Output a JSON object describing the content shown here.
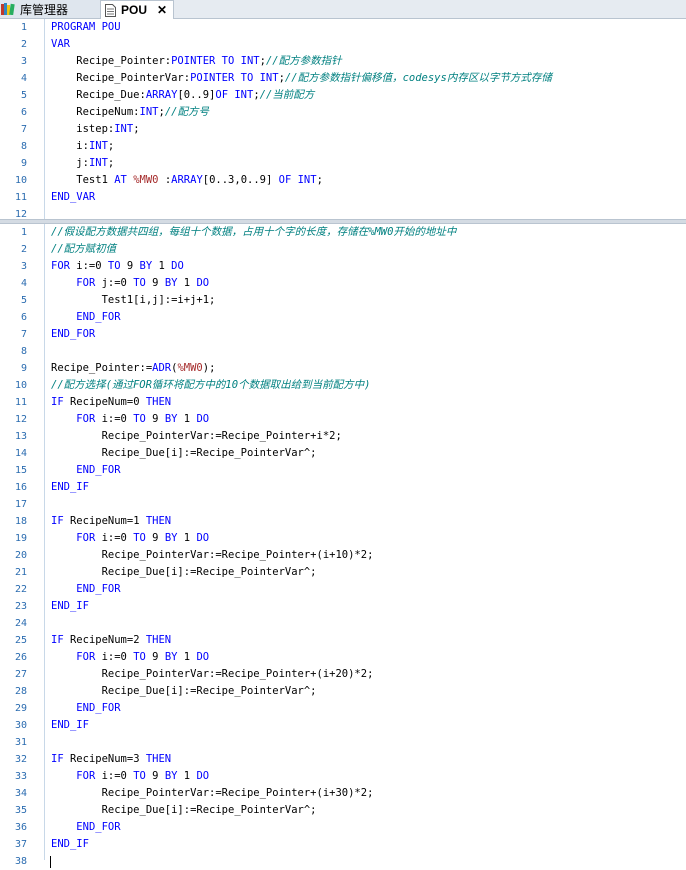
{
  "tabs": [
    {
      "label": "库管理器",
      "icon": "books-icon"
    },
    {
      "label": "POU",
      "icon": "document-icon",
      "close": "✕"
    }
  ],
  "declaration": [
    {
      "n": "1",
      "segs": [
        [
          "kw",
          "PROGRAM POU"
        ]
      ]
    },
    {
      "n": "2",
      "segs": [
        [
          "kw",
          "VAR"
        ]
      ]
    },
    {
      "n": "3",
      "segs": [
        [
          "nm",
          "    Recipe_Pointer:"
        ],
        [
          "kw",
          "POINTER TO INT"
        ],
        [
          "nm",
          ";"
        ],
        [
          "cm",
          "//配方参数指针"
        ]
      ]
    },
    {
      "n": "4",
      "segs": [
        [
          "nm",
          "    Recipe_PointerVar:"
        ],
        [
          "kw",
          "POINTER TO INT"
        ],
        [
          "nm",
          ";"
        ],
        [
          "cm",
          "//配方参数指针偏移值，codesys内存区以字节方式存储"
        ]
      ]
    },
    {
      "n": "5",
      "segs": [
        [
          "nm",
          "    Recipe_Due:"
        ],
        [
          "kw",
          "ARRAY"
        ],
        [
          "nm",
          "[0..9]"
        ],
        [
          "kw",
          "OF INT"
        ],
        [
          "nm",
          ";"
        ],
        [
          "cm",
          "//当前配方"
        ]
      ]
    },
    {
      "n": "6",
      "segs": [
        [
          "nm",
          "    RecipeNum:"
        ],
        [
          "kw",
          "INT"
        ],
        [
          "nm",
          ";"
        ],
        [
          "cm",
          "//配方号"
        ]
      ]
    },
    {
      "n": "7",
      "segs": [
        [
          "nm",
          "    istep:"
        ],
        [
          "kw",
          "INT"
        ],
        [
          "nm",
          ";"
        ]
      ]
    },
    {
      "n": "8",
      "segs": [
        [
          "nm",
          "    i:"
        ],
        [
          "kw",
          "INT"
        ],
        [
          "nm",
          ";"
        ]
      ]
    },
    {
      "n": "9",
      "segs": [
        [
          "nm",
          "    j:"
        ],
        [
          "kw",
          "INT"
        ],
        [
          "nm",
          ";"
        ]
      ]
    },
    {
      "n": "10",
      "segs": [
        [
          "nm",
          "    Test1 "
        ],
        [
          "kw",
          "AT"
        ],
        [
          "nm",
          " "
        ],
        [
          "cm2",
          "%MW0"
        ],
        [
          "nm",
          " :"
        ],
        [
          "kw",
          "ARRAY"
        ],
        [
          "nm",
          "[0..3,0..9] "
        ],
        [
          "kw",
          "OF INT"
        ],
        [
          "nm",
          ";"
        ]
      ]
    },
    {
      "n": "11",
      "segs": [
        [
          "kw",
          "END_VAR"
        ]
      ]
    },
    {
      "n": "12",
      "segs": []
    }
  ],
  "implementation": [
    {
      "n": "1",
      "segs": [
        [
          "cm",
          "//假设配方数据共四组，每组十个数据，占用十个字的长度，存储在%MW0开始的地址中"
        ]
      ]
    },
    {
      "n": "2",
      "segs": [
        [
          "cm",
          "//配方赋初值"
        ]
      ]
    },
    {
      "n": "3",
      "segs": [
        [
          "kw",
          "FOR"
        ],
        [
          "nm",
          " i:=0 "
        ],
        [
          "kw",
          "TO"
        ],
        [
          "nm",
          " 9 "
        ],
        [
          "kw",
          "BY"
        ],
        [
          "nm",
          " 1 "
        ],
        [
          "kw",
          "DO"
        ]
      ]
    },
    {
      "n": "4",
      "segs": [
        [
          "nm",
          "    "
        ],
        [
          "kw",
          "FOR"
        ],
        [
          "nm",
          " j:=0 "
        ],
        [
          "kw",
          "TO"
        ],
        [
          "nm",
          " 9 "
        ],
        [
          "kw",
          "BY"
        ],
        [
          "nm",
          " 1 "
        ],
        [
          "kw",
          "DO"
        ]
      ]
    },
    {
      "n": "5",
      "segs": [
        [
          "nm",
          "        Test1[i,j]:=i+j+1;"
        ]
      ]
    },
    {
      "n": "6",
      "segs": [
        [
          "nm",
          "    "
        ],
        [
          "kw",
          "END_FOR"
        ]
      ]
    },
    {
      "n": "7",
      "segs": [
        [
          "kw",
          "END_FOR"
        ]
      ]
    },
    {
      "n": "8",
      "segs": []
    },
    {
      "n": "9",
      "segs": [
        [
          "nm",
          "Recipe_Pointer:="
        ],
        [
          "kw",
          "ADR"
        ],
        [
          "nm",
          "("
        ],
        [
          "cm2",
          "%MW0"
        ],
        [
          "nm",
          ");"
        ]
      ]
    },
    {
      "n": "10",
      "segs": [
        [
          "cm",
          "//配方选择(通过FOR循环将配方中的10个数据取出给到当前配方中)"
        ]
      ]
    },
    {
      "n": "11",
      "segs": [
        [
          "kw",
          "IF"
        ],
        [
          "nm",
          " RecipeNum=0 "
        ],
        [
          "kw",
          "THEN"
        ]
      ]
    },
    {
      "n": "12",
      "segs": [
        [
          "nm",
          "    "
        ],
        [
          "kw",
          "FOR"
        ],
        [
          "nm",
          " i:=0 "
        ],
        [
          "kw",
          "TO"
        ],
        [
          "nm",
          " 9 "
        ],
        [
          "kw",
          "BY"
        ],
        [
          "nm",
          " 1 "
        ],
        [
          "kw",
          "DO"
        ]
      ]
    },
    {
      "n": "13",
      "segs": [
        [
          "nm",
          "        Recipe_PointerVar:=Recipe_Pointer+i*2;"
        ]
      ]
    },
    {
      "n": "14",
      "segs": [
        [
          "nm",
          "        Recipe_Due[i]:=Recipe_PointerVar^;"
        ]
      ]
    },
    {
      "n": "15",
      "segs": [
        [
          "nm",
          "    "
        ],
        [
          "kw",
          "END_FOR"
        ]
      ]
    },
    {
      "n": "16",
      "segs": [
        [
          "kw",
          "END_IF"
        ]
      ]
    },
    {
      "n": "17",
      "segs": []
    },
    {
      "n": "18",
      "segs": [
        [
          "kw",
          "IF"
        ],
        [
          "nm",
          " RecipeNum=1 "
        ],
        [
          "kw",
          "THEN"
        ]
      ]
    },
    {
      "n": "19",
      "segs": [
        [
          "nm",
          "    "
        ],
        [
          "kw",
          "FOR"
        ],
        [
          "nm",
          " i:=0 "
        ],
        [
          "kw",
          "TO"
        ],
        [
          "nm",
          " 9 "
        ],
        [
          "kw",
          "BY"
        ],
        [
          "nm",
          " 1 "
        ],
        [
          "kw",
          "DO"
        ]
      ]
    },
    {
      "n": "20",
      "segs": [
        [
          "nm",
          "        Recipe_PointerVar:=Recipe_Pointer+(i+10)*2;"
        ]
      ]
    },
    {
      "n": "21",
      "segs": [
        [
          "nm",
          "        Recipe_Due[i]:=Recipe_PointerVar^;"
        ]
      ]
    },
    {
      "n": "22",
      "segs": [
        [
          "nm",
          "    "
        ],
        [
          "kw",
          "END_FOR"
        ]
      ]
    },
    {
      "n": "23",
      "segs": [
        [
          "kw",
          "END_IF"
        ]
      ]
    },
    {
      "n": "24",
      "segs": []
    },
    {
      "n": "25",
      "segs": [
        [
          "kw",
          "IF"
        ],
        [
          "nm",
          " RecipeNum=2 "
        ],
        [
          "kw",
          "THEN"
        ]
      ]
    },
    {
      "n": "26",
      "segs": [
        [
          "nm",
          "    "
        ],
        [
          "kw",
          "FOR"
        ],
        [
          "nm",
          " i:=0 "
        ],
        [
          "kw",
          "TO"
        ],
        [
          "nm",
          " 9 "
        ],
        [
          "kw",
          "BY"
        ],
        [
          "nm",
          " 1 "
        ],
        [
          "kw",
          "DO"
        ]
      ]
    },
    {
      "n": "27",
      "segs": [
        [
          "nm",
          "        Recipe_PointerVar:=Recipe_Pointer+(i+20)*2;"
        ]
      ]
    },
    {
      "n": "28",
      "segs": [
        [
          "nm",
          "        Recipe_Due[i]:=Recipe_PointerVar^;"
        ]
      ]
    },
    {
      "n": "29",
      "segs": [
        [
          "nm",
          "    "
        ],
        [
          "kw",
          "END_FOR"
        ]
      ]
    },
    {
      "n": "30",
      "segs": [
        [
          "kw",
          "END_IF"
        ]
      ]
    },
    {
      "n": "31",
      "segs": []
    },
    {
      "n": "32",
      "segs": [
        [
          "kw",
          "IF"
        ],
        [
          "nm",
          " RecipeNum=3 "
        ],
        [
          "kw",
          "THEN"
        ]
      ]
    },
    {
      "n": "33",
      "segs": [
        [
          "nm",
          "    "
        ],
        [
          "kw",
          "FOR"
        ],
        [
          "nm",
          " i:=0 "
        ],
        [
          "kw",
          "TO"
        ],
        [
          "nm",
          " 9 "
        ],
        [
          "kw",
          "BY"
        ],
        [
          "nm",
          " 1 "
        ],
        [
          "kw",
          "DO"
        ]
      ]
    },
    {
      "n": "34",
      "segs": [
        [
          "nm",
          "        Recipe_PointerVar:=Recipe_Pointer+(i+30)*2;"
        ]
      ]
    },
    {
      "n": "35",
      "segs": [
        [
          "nm",
          "        Recipe_Due[i]:=Recipe_PointerVar^;"
        ]
      ]
    },
    {
      "n": "36",
      "segs": [
        [
          "nm",
          "    "
        ],
        [
          "kw",
          "END_FOR"
        ]
      ]
    },
    {
      "n": "37",
      "segs": [
        [
          "kw",
          "END_IF"
        ]
      ]
    },
    {
      "n": "38",
      "segs": []
    }
  ],
  "colors": {
    "keyword": "#0000ff",
    "comment": "#008080",
    "address": "#a52a2a",
    "line_number": "#2b6cb0"
  }
}
